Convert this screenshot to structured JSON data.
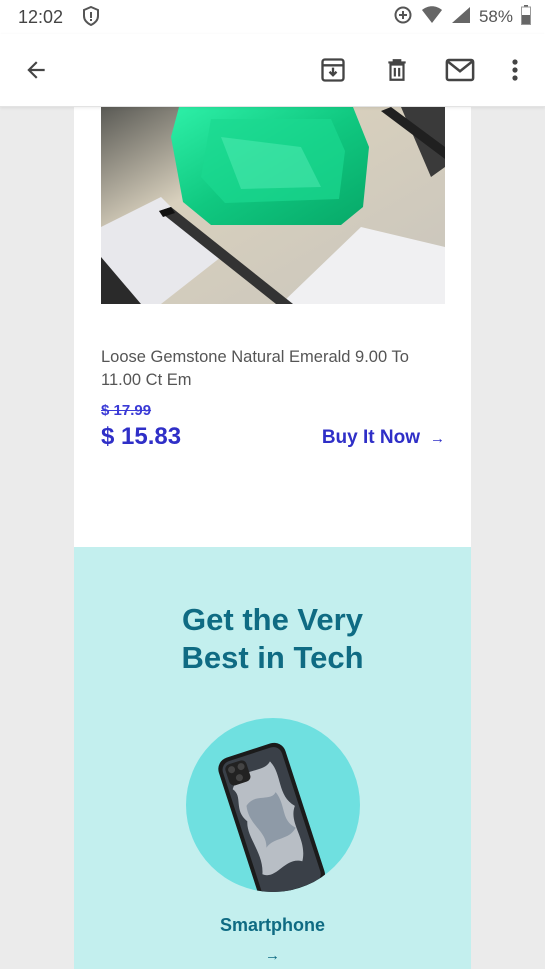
{
  "status_bar": {
    "time": "12:02",
    "battery_percent": "58%",
    "icons": [
      "shield-icon",
      "data-saver-icon",
      "wifi-icon",
      "signal-icon",
      "battery-icon"
    ]
  },
  "toolbar": {
    "icons": [
      "back-arrow-icon",
      "archive-icon",
      "trash-icon",
      "mail-icon",
      "more-vert-icon"
    ]
  },
  "product": {
    "title": "Loose Gemstone Natural Emerald 9.00 To 11.00 Ct Em",
    "old_price": "$ 17.99",
    "new_price": "$ 15.83",
    "buy_label": "Buy It Now",
    "buy_arrow": "→",
    "image": "emerald-gemstone-in-tweezers"
  },
  "tech_section": {
    "heading": "Get the Very Best in Tech",
    "item_label": "Smartphone",
    "item_arrow": "→",
    "image": "smartphone"
  },
  "colors": {
    "price_blue": "#2f2fc7",
    "tech_bg": "#c3efee",
    "tech_text": "#0f6b83",
    "circle": "#6fe0e0"
  }
}
